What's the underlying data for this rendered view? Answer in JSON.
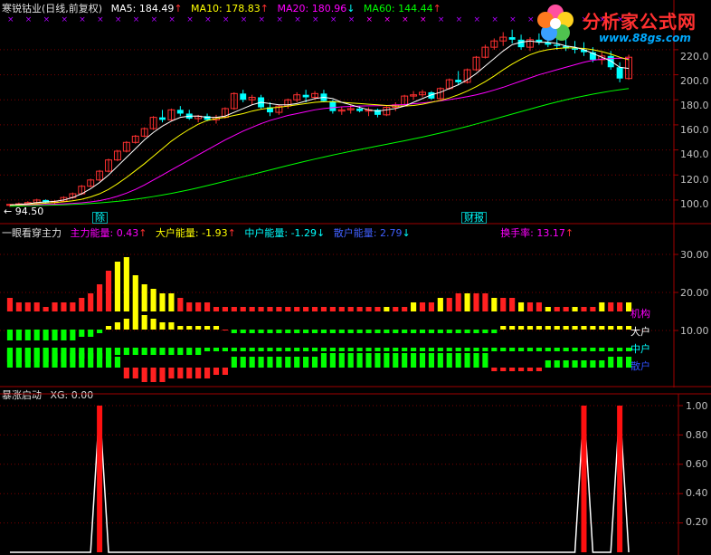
{
  "main_panel": {
    "title": "寒锐钴业(日线,前复权)",
    "ma5_label": "MA5:",
    "ma5_value": "184.49",
    "ma10_label": "MA10:",
    "ma10_value": "178.83",
    "ma20_label": "MA20:",
    "ma20_value": "180.96",
    "ma60_label": "MA60:",
    "ma60_value": "144.44",
    "ma5_arrow": "↑",
    "ma10_arrow": "↑",
    "ma20_arrow": "↓",
    "ma60_arrow": "↑",
    "low_marker": "← 94.50",
    "ex_div_tag": "除",
    "finance_tag": "财报",
    "y_axis": [
      "220.0",
      "200.0",
      "180.0",
      "160.0",
      "140.0",
      "120.0",
      "100.0"
    ],
    "colors": {
      "ma5": "#ffffff",
      "ma10": "#ffff00",
      "ma20": "#ff00ff",
      "ma60": "#00ff00",
      "up": "#ff3030",
      "down": "#00ffff"
    }
  },
  "energy_panel": {
    "title": "一眼看穿主力",
    "main_label": "主力能量:",
    "main_value": "0.43",
    "main_arrow": "↑",
    "big_label": "大户能量:",
    "big_value": "-1.93",
    "big_arrow": "↑",
    "mid_label": "中户能量:",
    "mid_value": "-1.29",
    "mid_arrow": "↓",
    "retail_label": "散户能量:",
    "retail_value": "2.79",
    "retail_arrow": "↓",
    "turnover_label": "换手率:",
    "turnover_value": "13.17",
    "turnover_arrow": "↑",
    "y_axis": [
      "30.00",
      "20.00",
      "10.00"
    ],
    "legend": [
      "机构",
      "大户",
      "中户",
      "散户"
    ]
  },
  "signal_panel": {
    "title": "暴涨启动",
    "xg_label": "XG:",
    "xg_value": "0.00",
    "y_axis": [
      "1.00",
      "0.80",
      "0.60",
      "0.40",
      "0.20"
    ]
  },
  "watermark": {
    "text": "分析家公式网",
    "url": "www.88gs.com"
  },
  "chart_data": {
    "type": "candlestick",
    "candles": [
      [
        96,
        97,
        94.5,
        96.5
      ],
      [
        96.5,
        98,
        95.5,
        97
      ],
      [
        97,
        99,
        96,
        98
      ],
      [
        98,
        101,
        97,
        100
      ],
      [
        100,
        100.5,
        97,
        98
      ],
      [
        98,
        100,
        97,
        99
      ],
      [
        99,
        103,
        98.5,
        102
      ],
      [
        102,
        106,
        101,
        105
      ],
      [
        105,
        112,
        104,
        111
      ],
      [
        111,
        117,
        110,
        116
      ],
      [
        116,
        124,
        115,
        123
      ],
      [
        123,
        133,
        122,
        132
      ],
      [
        132,
        140,
        131,
        139
      ],
      [
        139,
        147,
        138,
        146
      ],
      [
        146,
        152,
        145,
        151
      ],
      [
        151,
        158,
        150,
        157
      ],
      [
        157,
        167,
        156,
        166
      ],
      [
        166,
        172,
        162,
        164
      ],
      [
        164,
        173,
        163,
        172
      ],
      [
        172,
        175,
        167,
        169
      ],
      [
        169,
        172,
        164,
        165
      ],
      [
        165,
        168,
        162,
        167
      ],
      [
        167,
        169,
        163,
        164
      ],
      [
        164,
        168,
        161,
        166
      ],
      [
        166,
        174,
        165,
        173
      ],
      [
        173,
        186,
        172,
        185
      ],
      [
        185,
        188,
        178,
        180
      ],
      [
        180,
        184,
        176,
        182
      ],
      [
        182,
        184,
        173,
        174
      ],
      [
        174,
        178,
        167,
        170
      ],
      [
        170,
        176,
        168,
        175
      ],
      [
        175,
        181,
        173,
        180
      ],
      [
        180,
        186,
        178,
        184
      ],
      [
        184,
        188,
        178,
        182
      ],
      [
        182,
        187,
        180,
        185
      ],
      [
        185,
        188,
        178,
        179
      ],
      [
        179,
        180,
        169,
        171
      ],
      [
        171,
        174,
        168,
        172
      ],
      [
        172,
        176,
        169,
        173
      ],
      [
        173,
        175,
        170,
        171
      ],
      [
        171,
        174,
        167,
        172
      ],
      [
        172,
        173,
        166,
        168
      ],
      [
        168,
        175,
        167,
        174
      ],
      [
        174,
        178,
        171,
        176
      ],
      [
        176,
        184,
        175,
        183
      ],
      [
        183,
        187,
        180,
        184
      ],
      [
        184,
        188,
        182,
        186
      ],
      [
        186,
        187,
        180,
        181
      ],
      [
        181,
        190,
        180,
        189
      ],
      [
        189,
        197,
        188,
        196
      ],
      [
        196,
        203,
        192,
        194
      ],
      [
        194,
        205,
        193,
        204
      ],
      [
        204,
        215,
        203,
        214
      ],
      [
        214,
        224,
        213,
        222
      ],
      [
        222,
        229,
        220,
        227
      ],
      [
        227,
        234,
        223,
        230
      ],
      [
        230,
        236,
        225,
        228
      ],
      [
        228,
        232,
        220,
        222
      ],
      [
        222,
        230,
        219,
        228
      ],
      [
        228,
        233,
        224,
        226
      ],
      [
        226,
        232,
        222,
        224
      ],
      [
        224,
        230,
        220,
        223
      ],
      [
        223,
        229,
        219,
        221
      ],
      [
        221,
        227,
        217,
        220
      ],
      [
        220,
        226,
        215,
        218
      ],
      [
        218,
        222,
        210,
        212
      ],
      [
        212,
        218,
        208,
        215
      ],
      [
        215,
        219,
        204,
        206
      ],
      [
        206,
        210,
        194,
        197
      ],
      [
        197,
        216,
        196,
        214
      ]
    ],
    "ma5": [
      96,
      96.5,
      97,
      98,
      98.5,
      99,
      100,
      102,
      105,
      109,
      114,
      120,
      127,
      134,
      141,
      148,
      154,
      159,
      163,
      166,
      167,
      167,
      166,
      166,
      167,
      170,
      173,
      176,
      178,
      177,
      176,
      176,
      177,
      179,
      181,
      182,
      181,
      178,
      176,
      174,
      172,
      171,
      172,
      173,
      175,
      178,
      181,
      184,
      186,
      189,
      192,
      196,
      201,
      207,
      213,
      219,
      224,
      226,
      227,
      226,
      226,
      225,
      223,
      222,
      220,
      217,
      214,
      211,
      206,
      205
    ],
    "ma10": [
      96,
      96.2,
      96.6,
      97,
      97.5,
      98,
      98.6,
      99.4,
      100.6,
      102.5,
      105,
      108.5,
      113,
      118,
      123.5,
      129,
      135,
      141,
      147,
      152,
      156.5,
      160.5,
      163.5,
      165,
      166,
      167.5,
      169,
      171,
      172.5,
      173.5,
      174,
      175,
      176,
      177,
      178,
      178.5,
      178.5,
      178,
      177.5,
      177,
      176.5,
      176,
      175.5,
      175,
      175,
      175.5,
      176.5,
      178,
      179.5,
      181.5,
      184,
      187,
      190.5,
      194.5,
      199,
      204,
      208.5,
      212.5,
      216,
      218.5,
      220,
      221,
      221.5,
      221.5,
      221,
      220,
      218.5,
      216.5,
      214,
      212
    ],
    "ma20": [
      96,
      96,
      96.1,
      96.3,
      96.5,
      96.7,
      97,
      97.3,
      97.8,
      98.5,
      99.5,
      101,
      103,
      105.5,
      108.5,
      112,
      116,
      120,
      124,
      128,
      132,
      136,
      140,
      144,
      148,
      151.5,
      155,
      158,
      161,
      163.5,
      165.5,
      167.5,
      169,
      170.5,
      172,
      173,
      173.8,
      174.4,
      174.8,
      175,
      175.2,
      175.3,
      175.5,
      175.8,
      176.2,
      176.8,
      177.5,
      178.3,
      179.2,
      180.2,
      181.3,
      182.5,
      184,
      185.8,
      187.8,
      190,
      192.5,
      195,
      197.5,
      200,
      202,
      204,
      206,
      208,
      210,
      211.5,
      212.5,
      213,
      213.2,
      213
    ],
    "ma60": [
      95,
      95.2,
      95.4,
      95.6,
      95.8,
      96,
      96.2,
      96.5,
      96.8,
      97.2,
      97.7,
      98.3,
      99,
      99.8,
      100.7,
      101.7,
      102.8,
      104,
      105.3,
      106.7,
      108.2,
      109.8,
      111.5,
      113.2,
      115,
      116.8,
      118.6,
      120.4,
      122.2,
      124,
      125.8,
      127.6,
      129.3,
      131,
      132.7,
      134.3,
      135.9,
      137.4,
      138.9,
      140.3,
      141.7,
      143.1,
      144.5,
      145.9,
      147.3,
      148.8,
      150.3,
      151.9,
      153.5,
      155.2,
      157,
      158.8,
      160.7,
      162.6,
      164.6,
      166.6,
      168.6,
      170.6,
      172.6,
      174.6,
      176.5,
      178.3,
      180,
      181.6,
      183.1,
      184.5,
      185.8,
      187,
      188,
      189
    ],
    "energy_bars": {
      "main": [
        3,
        2,
        2,
        2,
        1,
        2,
        2,
        2,
        3,
        4,
        6,
        9,
        11,
        12,
        8,
        6,
        5,
        4,
        4,
        3,
        2,
        2,
        2,
        1,
        1,
        1,
        1,
        1,
        1,
        1,
        1,
        1,
        1,
        1,
        1,
        1,
        1,
        1,
        1,
        1,
        1,
        1,
        1,
        1,
        1,
        2,
        2,
        2,
        3,
        3,
        4,
        4,
        4,
        4,
        3,
        3,
        3,
        2,
        2,
        2,
        1,
        1,
        1,
        1,
        1,
        1,
        2,
        2,
        2,
        2
      ],
      "big": [
        -3,
        -3,
        -3,
        -3,
        -3,
        -3,
        -3,
        -3,
        -2,
        -2,
        -1,
        1,
        2,
        3,
        5,
        4,
        3,
        2,
        2,
        1,
        1,
        1,
        1,
        1,
        0,
        -1,
        -1,
        -1,
        -1,
        -1,
        -1,
        -1,
        -1,
        -1,
        -1,
        -1,
        -1,
        -1,
        -1,
        -1,
        -1,
        -1,
        -1,
        -1,
        -1,
        -1,
        -1,
        -1,
        -1,
        -1,
        -1,
        -1,
        -1,
        -1,
        -1,
        1,
        1,
        1,
        1,
        1,
        1,
        1,
        1,
        1,
        1,
        1,
        1,
        1,
        1,
        1
      ],
      "mid": [
        -4,
        -4,
        -4,
        -4,
        -4,
        -4,
        -4,
        -4,
        -3,
        -3,
        -3,
        -3,
        -2,
        -2,
        -2,
        -2,
        -2,
        -2,
        -2,
        -2,
        -2,
        -2,
        -1,
        -1,
        -1,
        -1,
        -1,
        -1,
        -1,
        -1,
        -1,
        -1,
        -1,
        -1,
        -1,
        -1,
        -1,
        -1,
        -1,
        -1,
        -1,
        -1,
        -1,
        -1,
        -1,
        -1,
        -1,
        -1,
        -1,
        -1,
        -1,
        -1,
        -1,
        -1,
        -1,
        -1,
        -1,
        -1,
        -1,
        -1,
        -1,
        -1,
        -1,
        -1,
        -1,
        -1,
        -1,
        -1,
        -1,
        -1
      ],
      "retail": [
        5,
        5,
        5,
        5,
        5,
        4,
        4,
        4,
        4,
        4,
        4,
        3,
        3,
        -3,
        -3,
        -4,
        -4,
        -4,
        -3,
        -3,
        -3,
        -3,
        -3,
        -2,
        -2,
        3,
        3,
        3,
        3,
        3,
        3,
        3,
        3,
        3,
        3,
        4,
        4,
        4,
        4,
        4,
        4,
        4,
        4,
        4,
        4,
        4,
        4,
        4,
        4,
        4,
        4,
        4,
        4,
        4,
        -1,
        -1,
        -1,
        -1,
        -1,
        -1,
        2,
        2,
        2,
        2,
        2,
        2,
        2,
        3,
        3,
        3
      ]
    },
    "xg_signals": [
      0,
      0,
      0,
      0,
      0,
      0,
      0,
      0,
      0,
      0,
      1,
      0,
      0,
      0,
      0,
      0,
      0,
      0,
      0,
      0,
      0,
      0,
      0,
      0,
      0,
      0,
      0,
      0,
      0,
      0,
      0,
      0,
      0,
      0,
      0,
      0,
      0,
      0,
      0,
      0,
      0,
      0,
      0,
      0,
      0,
      0,
      0,
      0,
      0,
      0,
      0,
      0,
      0,
      0,
      0,
      0,
      0,
      0,
      0,
      0,
      0,
      0,
      0,
      0,
      1,
      0,
      0,
      0,
      1,
      0
    ]
  }
}
